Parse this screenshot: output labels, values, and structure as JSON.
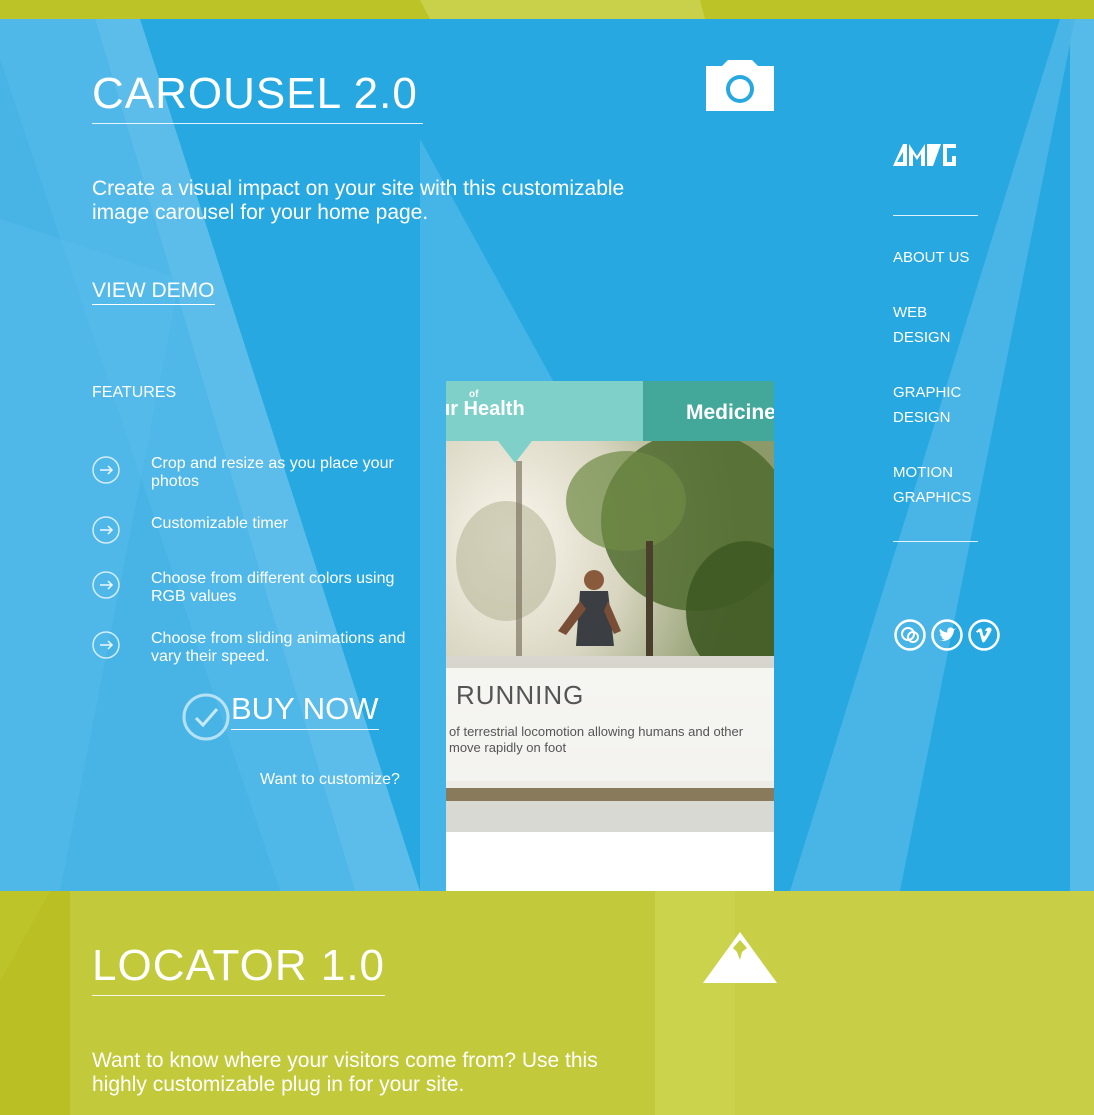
{
  "carousel": {
    "title": "CAROUSEL 2.0",
    "description": "Create a visual impact on your site with this customizable image carousel for your home page.",
    "demo_link": "VIEW DEMO",
    "features_label": "FEATURES",
    "features": [
      "Crop and resize as you place your photos",
      "Customizable timer",
      "Choose from different colors using RGB values",
      "Choose from sliding animations and vary their speed."
    ],
    "buy_label": "BUY NOW",
    "customize_link": "Want to customize?",
    "icon": "camera-icon"
  },
  "preview": {
    "tab1_prefix": "of",
    "tab1_label": "ur Health",
    "tab2_label": "Medicine",
    "caption_title": "RUNNING",
    "caption_text": "of terrestrial locomotion allowing humans and other move rapidly on foot"
  },
  "sidebar": {
    "logo": "AMG",
    "nav": [
      {
        "line1": "ABOUT US",
        "line2": ""
      },
      {
        "line1": "WEB",
        "line2": "DESIGN"
      },
      {
        "line1": "GRAPHIC",
        "line2": "DESIGN"
      },
      {
        "line1": "MOTION",
        "line2": "GRAPHICS"
      }
    ],
    "social": [
      "chat-icon",
      "twitter-icon",
      "vimeo-icon"
    ]
  },
  "locator": {
    "title": "LOCATOR 1.0",
    "description": "Want to know where your visitors come from? Use this highly customizable plug in for your site.",
    "icon": "mountain-icon"
  },
  "colors": {
    "blue": "#27a8e0",
    "green": "#c7cf45",
    "teal_light": "#7fd0c9",
    "teal_dark": "#43a89a"
  }
}
